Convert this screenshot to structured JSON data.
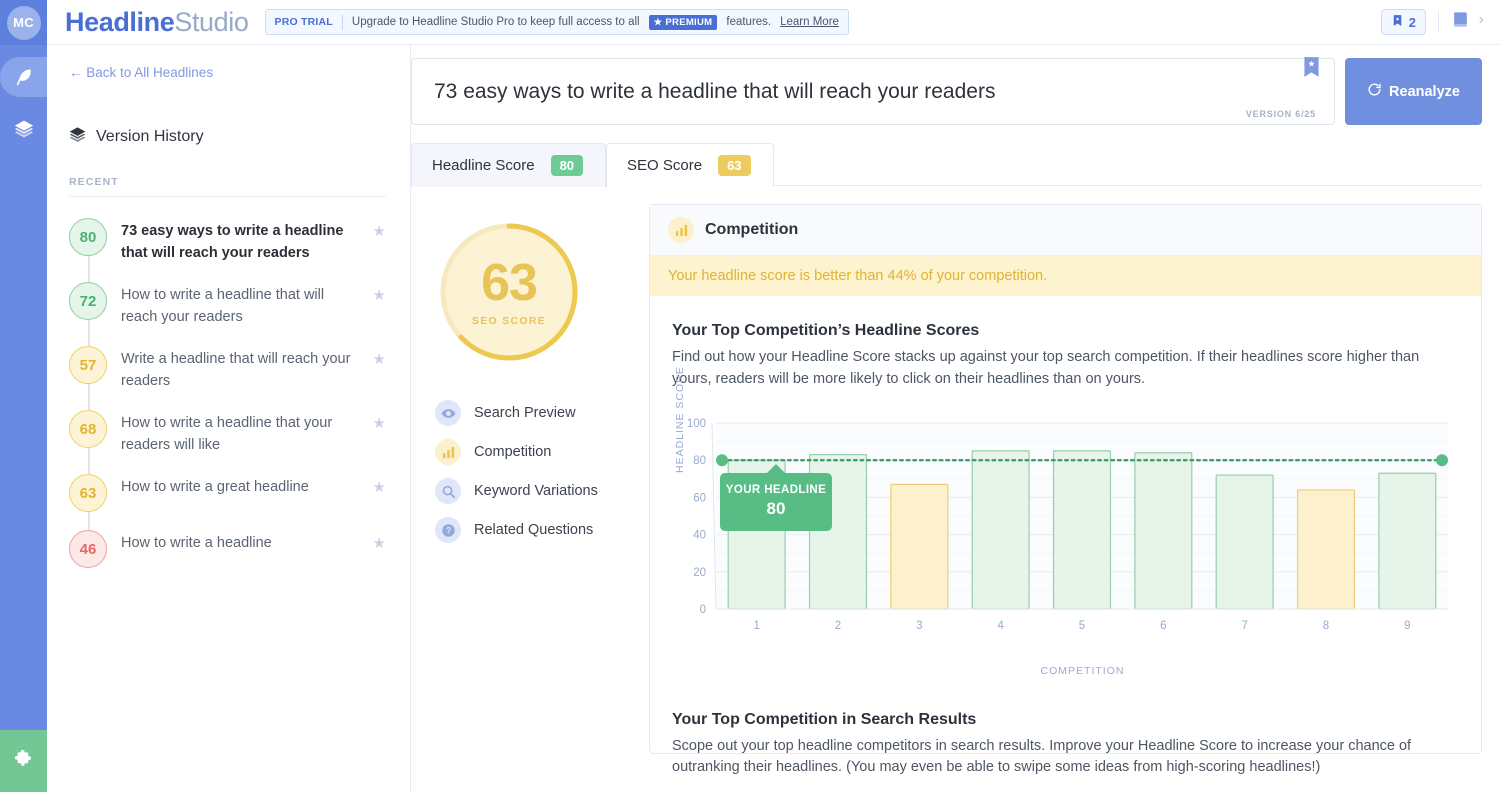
{
  "rail": {
    "avatar_initials": "MC",
    "items": [
      {
        "name": "feather-icon",
        "label": "Headlines"
      },
      {
        "name": "layers-icon",
        "label": "Library"
      }
    ],
    "bottom": {
      "name": "puzzle-icon",
      "label": "Extensions"
    }
  },
  "topbar": {
    "brand_bold": "Headline",
    "brand_light": "Studio",
    "promo_tag": "PRO TRIAL",
    "promo_text_before": "Upgrade to Headline Studio Pro to keep full access to all",
    "premium_badge": "PREMIUM",
    "promo_text_after": "features.",
    "learn_more": "Learn More",
    "bookmark_count": "2"
  },
  "sidebar": {
    "back_link": "← Back to All Headlines",
    "version_history_title": "Version History",
    "recent_label": "RECENT",
    "versions": [
      {
        "score": "80",
        "tone": "green",
        "text": "73 easy ways to write a headline that will reach your readers",
        "current": true
      },
      {
        "score": "72",
        "tone": "green",
        "text": "How to write a headline that will reach your readers",
        "current": false
      },
      {
        "score": "57",
        "tone": "yellow",
        "text": "Write a headline that will reach your readers",
        "current": false
      },
      {
        "score": "68",
        "tone": "yellow",
        "text": "How to write a headline that your readers will like",
        "current": false
      },
      {
        "score": "63",
        "tone": "yellow",
        "text": "How to write a great headline",
        "current": false
      },
      {
        "score": "46",
        "tone": "red",
        "text": "How to write a headline",
        "current": false
      }
    ]
  },
  "headline": {
    "text": "73 easy ways to write a headline that will reach your readers",
    "version_label": "VERSION 6/25",
    "reanalyze_label": "Reanalyze"
  },
  "tabs": [
    {
      "label": "Headline Score",
      "badge": "80",
      "tone": "green",
      "active": false
    },
    {
      "label": "SEO Score",
      "badge": "63",
      "tone": "yellow",
      "active": true
    }
  ],
  "seo": {
    "score": "63",
    "score_caption": "SEO SCORE",
    "ring_percent": 63,
    "nav": [
      {
        "label": "Search Preview",
        "icon": "eye-icon",
        "tone": "blue"
      },
      {
        "label": "Competition",
        "icon": "bar-chart-icon",
        "tone": "yellow"
      },
      {
        "label": "Keyword Variations",
        "icon": "search-icon",
        "tone": "blue"
      },
      {
        "label": "Related Questions",
        "icon": "question-icon",
        "tone": "blue"
      }
    ]
  },
  "panel": {
    "title": "Competition",
    "alert": "Your headline score is better than 44% of your competition.",
    "section1": {
      "heading": "Your Top Competition’s Headline Scores",
      "body": "Find out how your Headline Score stacks up against your top search competition. If their headlines score higher than yours, readers will be more likely to click on their headlines than on yours."
    },
    "section2": {
      "heading": "Your Top Competition in Search Results",
      "body": "Scope out your top headline competitors in search results. Improve your Headline Score to increase your chance of outranking their headlines. (You may even be able to swipe some ideas from high-scoring headlines!)"
    }
  },
  "chart_data": {
    "type": "bar",
    "title": "Your Top Competition’s Headline Scores",
    "xlabel": "COMPETITION",
    "ylabel": "HEADLINE SCORE",
    "categories": [
      "1",
      "2",
      "3",
      "4",
      "5",
      "6",
      "7",
      "8",
      "9"
    ],
    "values": [
      80,
      83,
      67,
      85,
      85,
      84,
      72,
      64,
      73
    ],
    "bar_tones": [
      "green",
      "green",
      "yellow",
      "green",
      "green",
      "green",
      "green",
      "yellow",
      "green"
    ],
    "yticks": [
      0,
      20,
      40,
      60,
      80,
      100
    ],
    "ylim": [
      0,
      100
    ],
    "grid": true,
    "legend": "none",
    "reference_line": {
      "label": "YOUR HEADLINE",
      "value": 80,
      "style": "dotted",
      "color": "#3f9e6c"
    },
    "tooltip": {
      "title": "YOUR HEADLINE",
      "value": "80"
    },
    "colors": {
      "green_fill": "#e6f4ea",
      "green_stroke": "#96cfac",
      "yellow_fill": "#fdf0cd",
      "yellow_stroke": "#efcf73"
    }
  },
  "colors": {
    "brand_blue": "#4a6fd4",
    "rail_blue": "#6989e2",
    "accent_green": "#6dcb93",
    "accent_yellow": "#eecb5e",
    "accent_red": "#e46a6a"
  }
}
